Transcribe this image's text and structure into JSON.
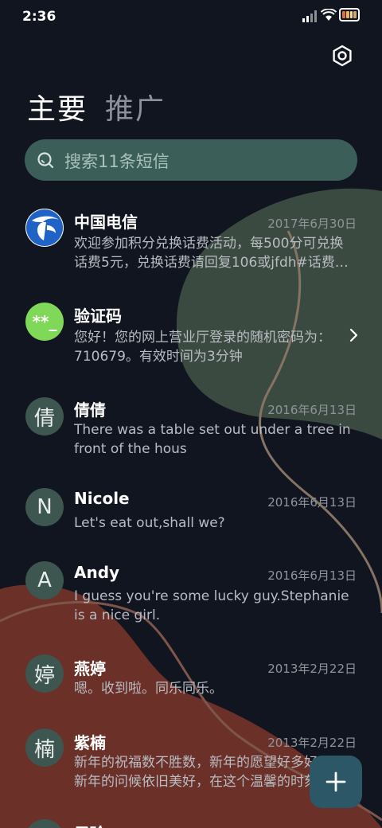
{
  "status_bar": {
    "time": "2:36"
  },
  "tabs": [
    {
      "label": "主要"
    },
    {
      "label": "推广"
    }
  ],
  "search": {
    "placeholder": "搜索11条短信"
  },
  "conversations": [
    {
      "name": "中国电信",
      "date": "2017年6月30日",
      "line1": "欢迎参加积分兑换话费活动，每500分可兑换",
      "line2": "话费5元，兑换话费请回复106或jfdh#话费…",
      "avatar_icon": "china-telecom-logo"
    },
    {
      "name": "验证码",
      "date": "",
      "line1": "您好！您的网上营业厅登录的随机密码为：",
      "line2": "710679。有效时间为3分钟",
      "avatar_text": "**_"
    },
    {
      "name": "倩倩",
      "date": "2016年6月13日",
      "line1": "There was a table set out under a tree in",
      "line2": "front of the hous",
      "avatar_text": "倩"
    },
    {
      "name": "Nicole",
      "date": "2016年6月13日",
      "line1": "Let's eat out,shall we?",
      "line2": "",
      "avatar_text": "N"
    },
    {
      "name": "Andy",
      "date": "2016年6月13日",
      "line1": "I guess you're some lucky guy.Stephanie",
      "line2": "is a nice girl.",
      "avatar_text": "A"
    },
    {
      "name": "燕婷",
      "date": "2013年2月22日",
      "line1": "嗯。收到啦。同乐同乐。",
      "line2": "",
      "avatar_text": "婷"
    },
    {
      "name": "紫楠",
      "date": "2013年2月22日",
      "line1": "新年的祝福数不胜数，新年的愿望好多好多，",
      "line2": "新年的问候依旧美好，在这个温馨的时刻…",
      "avatar_text": "楠"
    },
    {
      "name": "子玲",
      "date": "",
      "line1": "",
      "line2": "",
      "avatar_text": ""
    }
  ],
  "icons": {
    "settings": "gear-icon",
    "search": "search-icon",
    "chevron": "chevron-right-icon",
    "fab": "plus-icon"
  },
  "colors": {
    "background": "#111520",
    "accent": "#3b5f58",
    "fab": "#2c5767",
    "verification_avatar": "#7fd857"
  }
}
